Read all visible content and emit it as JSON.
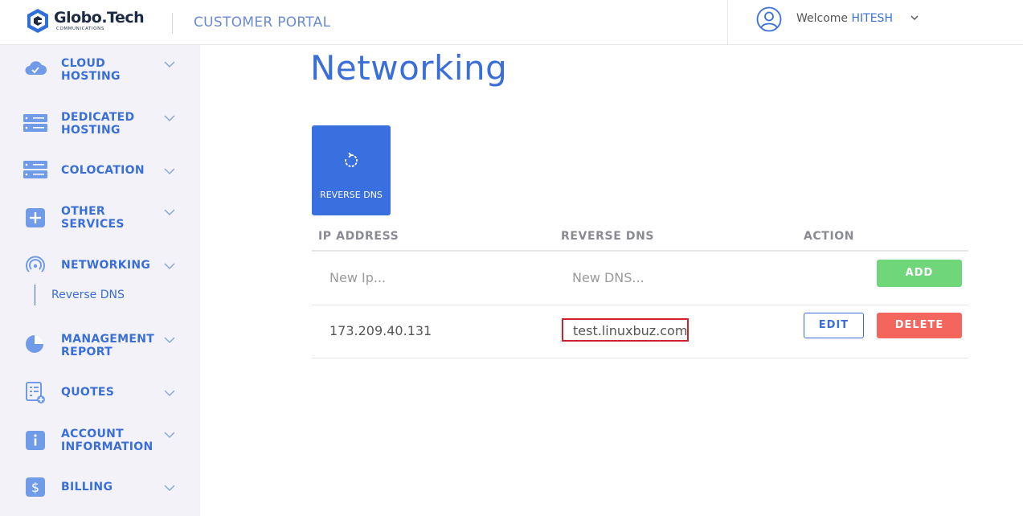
{
  "brand": {
    "name": "Globo.Tech",
    "sub": "COMMUNICATIONS",
    "portal_title": "CUSTOMER PORTAL"
  },
  "user": {
    "welcome": "Welcome",
    "name": "HITESH"
  },
  "sidebar": {
    "items": [
      {
        "label_line1": "CLOUD",
        "label_line2": "HOSTING",
        "icon": "cloud-check-icon"
      },
      {
        "label_line1": "DEDICATED",
        "label_line2": "HOSTING",
        "icon": "server-icon"
      },
      {
        "label_line1": "COLOCATION",
        "label_line2": "",
        "icon": "server-icon"
      },
      {
        "label_line1": "OTHER",
        "label_line2": "SERVICES",
        "icon": "plus-icon"
      },
      {
        "label_line1": "NETWORKING",
        "label_line2": "",
        "icon": "wifi-icon"
      },
      {
        "label_line1": "MANAGEMENT",
        "label_line2": "REPORT",
        "icon": "pie-chart-icon"
      },
      {
        "label_line1": "QUOTES",
        "label_line2": "",
        "icon": "quote-document-icon"
      },
      {
        "label_line1": "ACCOUNT",
        "label_line2": "INFORMATION",
        "icon": "info-icon"
      },
      {
        "label_line1": "BILLING",
        "label_line2": "",
        "icon": "dollar-icon"
      }
    ],
    "sub_item": "Reverse DNS"
  },
  "main": {
    "title": "Networking",
    "tile_label": "REVERSE DNS",
    "table": {
      "headers": [
        "IP ADDRESS",
        "REVERSE DNS",
        "ACTION"
      ],
      "new_ip_placeholder": "New Ip...",
      "new_dns_placeholder": "New DNS...",
      "add_label": "ADD",
      "rows": [
        {
          "ip": "173.209.40.131",
          "dns": "test.linuxbuz.com",
          "edit_label": "EDIT",
          "delete_label": "DELETE"
        }
      ]
    }
  },
  "colors": {
    "accent": "#3a6fd8",
    "add": "#6fd77a",
    "delete": "#f4655d",
    "highlight": "#d0202a"
  }
}
